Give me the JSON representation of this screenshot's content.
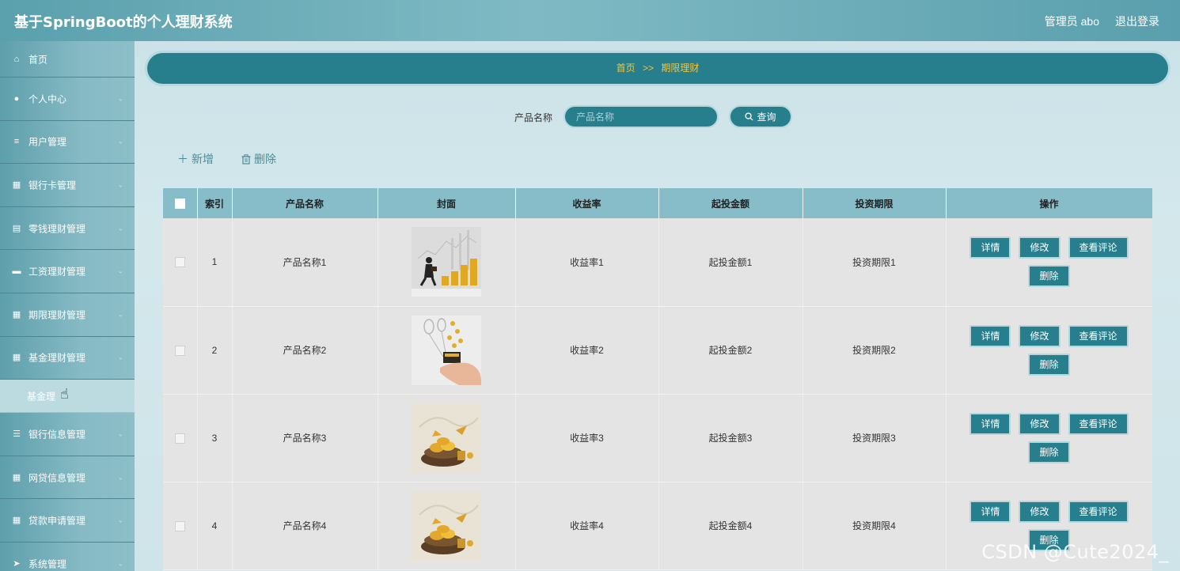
{
  "header": {
    "app_title": "基于SpringBoot的个人理财系统",
    "user_label": "管理员 abo",
    "logout_label": "退出登录"
  },
  "sidebar": {
    "items": [
      {
        "label": "首页",
        "icon": "home-icon",
        "glyph": "⌂"
      },
      {
        "label": "个人中心",
        "icon": "user-icon",
        "glyph": "●"
      },
      {
        "label": "用户管理",
        "icon": "sliders-icon",
        "glyph": "≡"
      },
      {
        "label": "银行卡管理",
        "icon": "grid-icon",
        "glyph": "▦"
      },
      {
        "label": "零钱理财管理",
        "icon": "document-icon",
        "glyph": "▤"
      },
      {
        "label": "工资理财管理",
        "icon": "ticket-icon",
        "glyph": "▬"
      },
      {
        "label": "期限理财管理",
        "icon": "grid-icon",
        "glyph": "▦"
      },
      {
        "label": "基金理财管理",
        "icon": "grid-icon",
        "glyph": "▦"
      },
      {
        "label": "银行信息管理",
        "icon": "list-icon",
        "glyph": "☰"
      },
      {
        "label": "网贷信息管理",
        "icon": "grid-icon",
        "glyph": "▦"
      },
      {
        "label": "贷款申请管理",
        "icon": "grid-icon",
        "glyph": "▦"
      },
      {
        "label": "系统管理",
        "icon": "send-icon",
        "glyph": "➤"
      }
    ],
    "sub_item": "基金理"
  },
  "breadcrumb": {
    "home": "首页",
    "separator": ">>",
    "current": "期限理财"
  },
  "search": {
    "label": "产品名称",
    "placeholder": "产品名称",
    "button_label": "查询"
  },
  "actions": {
    "add_label": "新增",
    "delete_label": "删除"
  },
  "table": {
    "columns": [
      "索引",
      "产品名称",
      "封面",
      "收益率",
      "起投金额",
      "投资期限",
      "操作"
    ],
    "rows": [
      {
        "index": "1",
        "name": "产品名称1",
        "cover": "businessman-coins-image",
        "rate": "收益率1",
        "amount": "起投金额1",
        "term": "投资期限1"
      },
      {
        "index": "2",
        "name": "产品名称2",
        "cover": "hand-coins-image",
        "rate": "收益率2",
        "amount": "起投金额2",
        "term": "投资期限2"
      },
      {
        "index": "3",
        "name": "产品名称3",
        "cover": "gold-nest-image",
        "rate": "收益率3",
        "amount": "起投金额3",
        "term": "投资期限3"
      },
      {
        "index": "4",
        "name": "产品名称4",
        "cover": "gold-nest-image",
        "rate": "收益率4",
        "amount": "起投金额4",
        "term": "投资期限4"
      }
    ],
    "row_buttons": [
      "详情",
      "修改",
      "查看评论",
      "删除"
    ]
  },
  "watermark": "CSDN @Cute2024_",
  "colors": {
    "primary": "#277f8d",
    "breadcrumb_text": "#f4c43b",
    "header_bg": "#86bdc8",
    "row_bg": "#e4e4e4"
  }
}
